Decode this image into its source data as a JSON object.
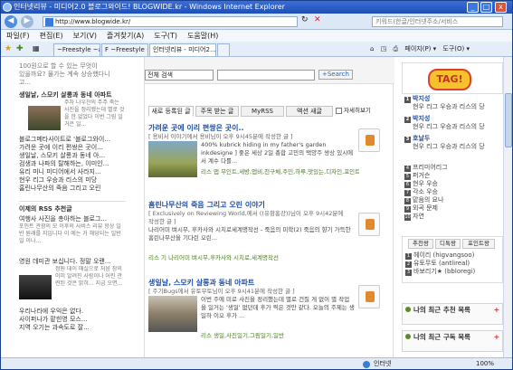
{
  "window": {
    "title": "인터넷리뷰 - 미디어2.0 블로그와이드! BLOGWIDE.kr - Windows Internet Explorer",
    "min": "_",
    "max": "□",
    "close": "x"
  },
  "address": {
    "url": "http://www.blogwide.kr/",
    "search": "키워드(한글/인터넷주소/서비스"
  },
  "menu": [
    "파일(F)",
    "편집(E)",
    "보기(V)",
    "즐겨찾기(A)",
    "도구(T)",
    "도움말(H)"
  ],
  "tabs": [
    {
      "label": "~Freestyle ~a"
    },
    {
      "label": "F ~Freestyle ~a"
    },
    {
      "label": "인터넷리뷰 - 미디어2..."
    }
  ],
  "toolbar": {
    "home": "⌂",
    "feeds": "◳",
    "print": "⎙",
    "page": "페이지(P) ▾",
    "tools": "도구(O) ▾"
  },
  "left": {
    "top_texts": [
      "100원으로 할 수 있는 무엇이",
      "있을까요? 물가는 계속 상승했다니",
      "고...",
      "생일날, 스모키 살롱과 동네 아파트",
      "주차 나우찬의 주주 죽는 사진을 정리했는데 별로 것을 한 없었다 이번 그림 일 거은 일..."
    ],
    "list": [
      "블로그메타사이트로 '블로그와이...",
      "가려운 곳에 이리 편쌍은 곳이...",
      "생일날, 스모키 살롱과 동네 아...",
      "검생과 나파의 탈해하는, 이미인...",
      "유리 미니 미디어에서 사라지...",
      "현우 리그 우승과 리스의 미당",
      "홈린나무산의 죽음 그리고 오린"
    ],
    "rss_title": "이제의 RSS 추천글",
    "rss_items": [
      "여행사 사진을 총아하는 블로그...",
      "포인트 관광의 모 이후의 사비스 리뷰 항상 일반 원래를 지입니다 이 에는 거 해당되는 일반일 이나...",
      "영원 데미관 보십니다. 정말 오랜...",
      "정원 데이 매실으로 처음 장의 이미 알려진 사람이나 어린 관련된 것은 밝혀... 지금 오면..."
    ],
    "bottom_list": [
      "우리나라에 우익은 없다.",
      "사이퍼나가 팥힌영 모스...",
      "지역 오기는 과속도로 잘..."
    ]
  },
  "center": {
    "search": {
      "select": "전체 검색",
      "button": "+Search"
    },
    "tabs": [
      "새로 등록된 글",
      "주목 받는 글",
      "MyRSS",
      "액션 새글"
    ],
    "checkbox_label": "자세히보기",
    "posts": [
      {
        "title": "가려운 곳에 이리 편쌍은 곳이..",
        "meta": "[ 용비서 이야기에서 용비님이 오후 9시45분에 작성한 글 ]",
        "body": "400% kubrick hiding in my father's garden inkdesigne ] 좋은 세상 2일 총합 고민의 택양주 쌍상 있시에서 계수 다를...",
        "tags": "리스 앱 무인트,세방,앱비,천구체,주민,하루,맛있는,디자인,포인트,방송,앱, Life",
        "votes": "8"
      },
      {
        "title": "홈린나무산의 죽음 그리고 오린 이야기",
        "meta": "[ Exclusively on Reviewing World,에서 ((유항홍강))님이 오후 9시42분에 작성한 글 ]",
        "body": "나리어미 벼시무, 후카사와 시치로세계명작선 - 죽음의 미학(2) 죽음의 향기 가득한 홈린나무산을 기다린 오린...",
        "tags": "리스 기 나리어미 벼시무,후카사와 시치로,세계명작선",
        "votes": "8"
      },
      {
        "title": "생일날, 스모키 살롱과 동네 아파트",
        "meta": "[ 주기Bugs에서 유토무토님이 오후 9시41분에 작성한 글 ]",
        "body": "이번 주에 미로 사진을 정리했는데 별로 건질 게 없이 별 작업을 일거는 '생일' 없던데 후가 찍은 것만 같다. 오늘의 주제는 생일하 이오 후가 ...",
        "tags": "리스 생일,사진일기,그림일기,일반",
        "votes": "8"
      }
    ]
  },
  "right": {
    "logo": "TAG!",
    "hot1": [
      {
        "num": "1",
        "label": "박지성"
      },
      {
        "num": "",
        "label": "현우 리그 우승과 리스의 당"
      },
      {
        "num": "2",
        "label": "박지성"
      },
      {
        "num": "",
        "label": "현우 리그 우승과 리스의 당"
      },
      {
        "num": "3",
        "label": "호날두"
      },
      {
        "num": "",
        "label": "현우 리그 우승과 리스의 당"
      }
    ],
    "ranked": [
      "프리미어리그",
      "퍼거슨",
      "현우 우승",
      "각소 우승",
      "맡음의 요나",
      "외곡 문제",
      "자연"
    ],
    "user_tabs": [
      "추천왕",
      "디톡왕",
      "포인트왕"
    ],
    "users": [
      "헤이리 (higvangsoo)",
      "유토무토 (antlireal)",
      "바보리기★ (bbloregi)"
    ],
    "sections": [
      "나의 최근 추천 목록",
      "나의 최근 구독 목록"
    ],
    "more": "+"
  },
  "status": {
    "zone": "인터넷",
    "zoom": "100%"
  }
}
